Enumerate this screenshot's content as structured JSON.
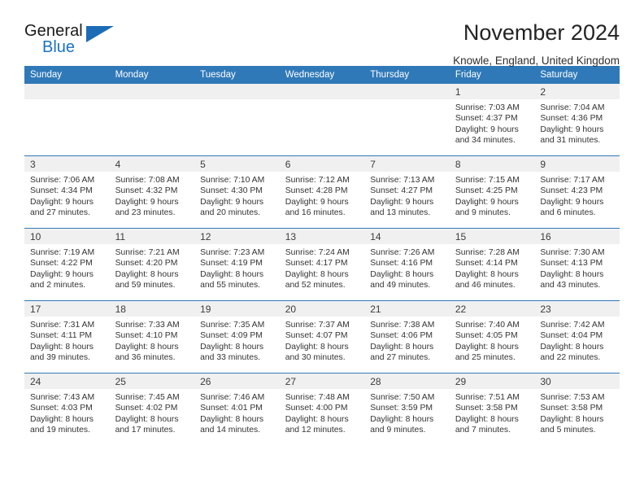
{
  "brand": {
    "name_part1": "General",
    "name_part2": "Blue",
    "triangle_color": "#1b6cb5",
    "blue_text_color": "#1b72c0"
  },
  "header": {
    "title": "November 2024",
    "subtitle": "Knowle, England, United Kingdom"
  },
  "theme": {
    "header_blue": "#3079b8",
    "date_band_gray": "#f0f0f0",
    "text_color": "#333333"
  },
  "calendar": {
    "weekday_headers": [
      "Sunday",
      "Monday",
      "Tuesday",
      "Wednesday",
      "Thursday",
      "Friday",
      "Saturday"
    ],
    "weeks": [
      [
        {
          "day": "",
          "info": ""
        },
        {
          "day": "",
          "info": ""
        },
        {
          "day": "",
          "info": ""
        },
        {
          "day": "",
          "info": ""
        },
        {
          "day": "",
          "info": ""
        },
        {
          "day": "1",
          "info": "Sunrise: 7:03 AM\nSunset: 4:37 PM\nDaylight: 9 hours\nand 34 minutes."
        },
        {
          "day": "2",
          "info": "Sunrise: 7:04 AM\nSunset: 4:36 PM\nDaylight: 9 hours\nand 31 minutes."
        }
      ],
      [
        {
          "day": "3",
          "info": "Sunrise: 7:06 AM\nSunset: 4:34 PM\nDaylight: 9 hours\nand 27 minutes."
        },
        {
          "day": "4",
          "info": "Sunrise: 7:08 AM\nSunset: 4:32 PM\nDaylight: 9 hours\nand 23 minutes."
        },
        {
          "day": "5",
          "info": "Sunrise: 7:10 AM\nSunset: 4:30 PM\nDaylight: 9 hours\nand 20 minutes."
        },
        {
          "day": "6",
          "info": "Sunrise: 7:12 AM\nSunset: 4:28 PM\nDaylight: 9 hours\nand 16 minutes."
        },
        {
          "day": "7",
          "info": "Sunrise: 7:13 AM\nSunset: 4:27 PM\nDaylight: 9 hours\nand 13 minutes."
        },
        {
          "day": "8",
          "info": "Sunrise: 7:15 AM\nSunset: 4:25 PM\nDaylight: 9 hours\nand 9 minutes."
        },
        {
          "day": "9",
          "info": "Sunrise: 7:17 AM\nSunset: 4:23 PM\nDaylight: 9 hours\nand 6 minutes."
        }
      ],
      [
        {
          "day": "10",
          "info": "Sunrise: 7:19 AM\nSunset: 4:22 PM\nDaylight: 9 hours\nand 2 minutes."
        },
        {
          "day": "11",
          "info": "Sunrise: 7:21 AM\nSunset: 4:20 PM\nDaylight: 8 hours\nand 59 minutes."
        },
        {
          "day": "12",
          "info": "Sunrise: 7:23 AM\nSunset: 4:19 PM\nDaylight: 8 hours\nand 55 minutes."
        },
        {
          "day": "13",
          "info": "Sunrise: 7:24 AM\nSunset: 4:17 PM\nDaylight: 8 hours\nand 52 minutes."
        },
        {
          "day": "14",
          "info": "Sunrise: 7:26 AM\nSunset: 4:16 PM\nDaylight: 8 hours\nand 49 minutes."
        },
        {
          "day": "15",
          "info": "Sunrise: 7:28 AM\nSunset: 4:14 PM\nDaylight: 8 hours\nand 46 minutes."
        },
        {
          "day": "16",
          "info": "Sunrise: 7:30 AM\nSunset: 4:13 PM\nDaylight: 8 hours\nand 43 minutes."
        }
      ],
      [
        {
          "day": "17",
          "info": "Sunrise: 7:31 AM\nSunset: 4:11 PM\nDaylight: 8 hours\nand 39 minutes."
        },
        {
          "day": "18",
          "info": "Sunrise: 7:33 AM\nSunset: 4:10 PM\nDaylight: 8 hours\nand 36 minutes."
        },
        {
          "day": "19",
          "info": "Sunrise: 7:35 AM\nSunset: 4:09 PM\nDaylight: 8 hours\nand 33 minutes."
        },
        {
          "day": "20",
          "info": "Sunrise: 7:37 AM\nSunset: 4:07 PM\nDaylight: 8 hours\nand 30 minutes."
        },
        {
          "day": "21",
          "info": "Sunrise: 7:38 AM\nSunset: 4:06 PM\nDaylight: 8 hours\nand 27 minutes."
        },
        {
          "day": "22",
          "info": "Sunrise: 7:40 AM\nSunset: 4:05 PM\nDaylight: 8 hours\nand 25 minutes."
        },
        {
          "day": "23",
          "info": "Sunrise: 7:42 AM\nSunset: 4:04 PM\nDaylight: 8 hours\nand 22 minutes."
        }
      ],
      [
        {
          "day": "24",
          "info": "Sunrise: 7:43 AM\nSunset: 4:03 PM\nDaylight: 8 hours\nand 19 minutes."
        },
        {
          "day": "25",
          "info": "Sunrise: 7:45 AM\nSunset: 4:02 PM\nDaylight: 8 hours\nand 17 minutes."
        },
        {
          "day": "26",
          "info": "Sunrise: 7:46 AM\nSunset: 4:01 PM\nDaylight: 8 hours\nand 14 minutes."
        },
        {
          "day": "27",
          "info": "Sunrise: 7:48 AM\nSunset: 4:00 PM\nDaylight: 8 hours\nand 12 minutes."
        },
        {
          "day": "28",
          "info": "Sunrise: 7:50 AM\nSunset: 3:59 PM\nDaylight: 8 hours\nand 9 minutes."
        },
        {
          "day": "29",
          "info": "Sunrise: 7:51 AM\nSunset: 3:58 PM\nDaylight: 8 hours\nand 7 minutes."
        },
        {
          "day": "30",
          "info": "Sunrise: 7:53 AM\nSunset: 3:58 PM\nDaylight: 8 hours\nand 5 minutes."
        }
      ]
    ]
  }
}
